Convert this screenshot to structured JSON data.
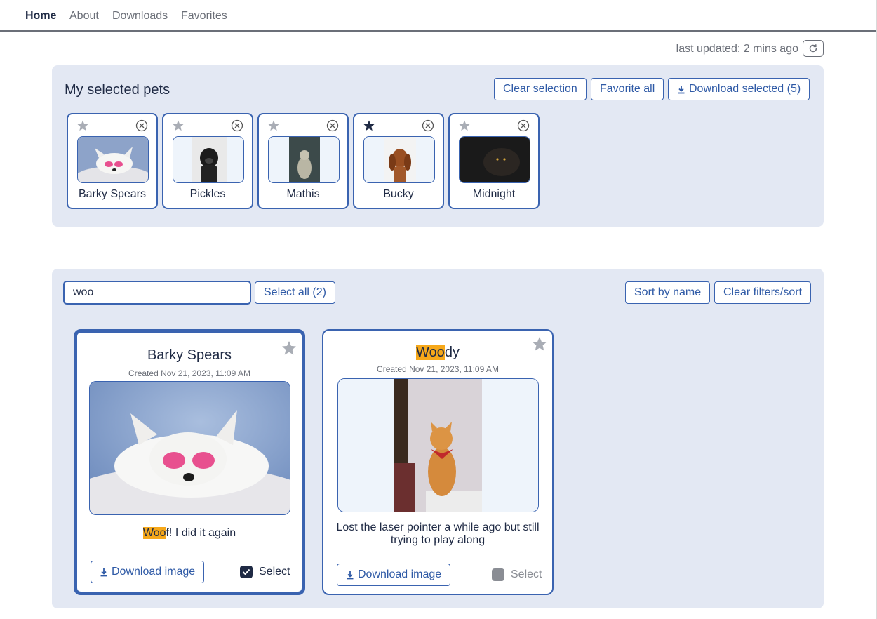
{
  "nav": {
    "items": [
      {
        "label": "Home",
        "active": true
      },
      {
        "label": "About",
        "active": false
      },
      {
        "label": "Downloads",
        "active": false
      },
      {
        "label": "Favorites",
        "active": false
      }
    ]
  },
  "status": {
    "last_updated": "last updated: 2 mins ago",
    "refresh_icon": "refresh-icon"
  },
  "selected_panel": {
    "title": "My selected pets",
    "clear_selection_label": "Clear selection",
    "favorite_all_label": "Favorite all",
    "download_selected_label": "Download selected (5)",
    "pets": [
      {
        "name": "Barky Spears",
        "favorite": false
      },
      {
        "name": "Pickles",
        "favorite": false
      },
      {
        "name": "Mathis",
        "favorite": false
      },
      {
        "name": "Bucky",
        "favorite": true
      },
      {
        "name": "Midnight",
        "favorite": false
      }
    ]
  },
  "list_panel": {
    "search_value": "woo",
    "select_all_label": "Select all (2)",
    "sort_label": "Sort by name",
    "clear_filters_label": "Clear filters/sort",
    "cards": [
      {
        "title_highlight": "",
        "title_rest": "Barky Spears",
        "created": "Created Nov 21, 2023, 11:09 AM",
        "desc_highlight": "Woo",
        "desc_rest": "f! I did it again",
        "download_label": "Download image",
        "select_label": "Select",
        "selected": true,
        "favorite": false
      },
      {
        "title_highlight": "Woo",
        "title_rest": "dy",
        "created": "Created Nov 21, 2023, 11:09 AM",
        "desc_highlight": "",
        "desc_rest": "Lost the laser pointer a while ago but still trying to play along",
        "download_label": "Download image",
        "select_label": "Select",
        "selected": false,
        "favorite": false
      }
    ]
  },
  "colors": {
    "accent": "#3a63b0",
    "panel_bg": "#e3e8f3",
    "text_dark": "#1f2a44",
    "text_muted": "#6b6f78",
    "highlight": "#f6a81a",
    "star_off": "#a9adb5",
    "star_on": "#1f2a44"
  }
}
